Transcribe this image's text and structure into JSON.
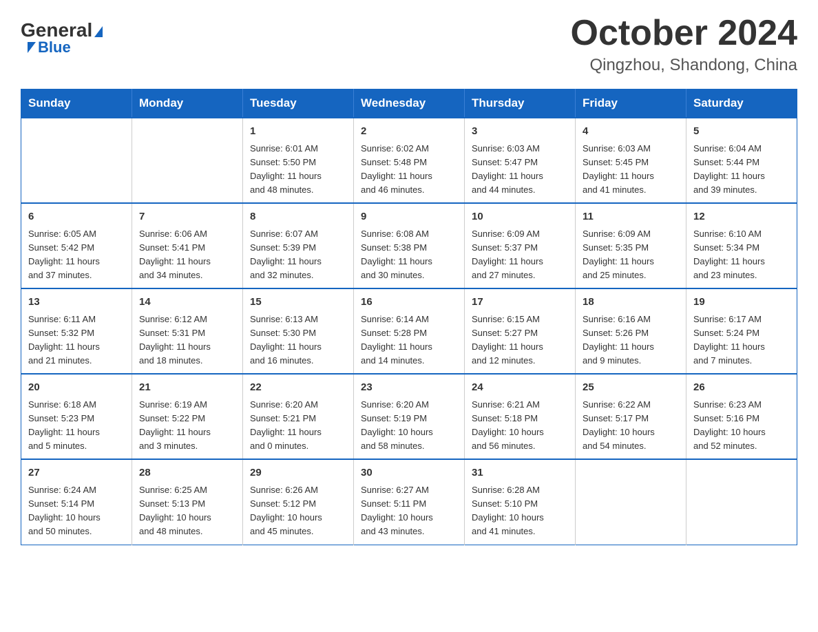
{
  "header": {
    "logo_general": "General",
    "logo_blue": "Blue",
    "month": "October 2024",
    "location": "Qingzhou, Shandong, China"
  },
  "weekdays": [
    "Sunday",
    "Monday",
    "Tuesday",
    "Wednesday",
    "Thursday",
    "Friday",
    "Saturday"
  ],
  "weeks": [
    [
      {
        "day": "",
        "info": ""
      },
      {
        "day": "",
        "info": ""
      },
      {
        "day": "1",
        "info": "Sunrise: 6:01 AM\nSunset: 5:50 PM\nDaylight: 11 hours\nand 48 minutes."
      },
      {
        "day": "2",
        "info": "Sunrise: 6:02 AM\nSunset: 5:48 PM\nDaylight: 11 hours\nand 46 minutes."
      },
      {
        "day": "3",
        "info": "Sunrise: 6:03 AM\nSunset: 5:47 PM\nDaylight: 11 hours\nand 44 minutes."
      },
      {
        "day": "4",
        "info": "Sunrise: 6:03 AM\nSunset: 5:45 PM\nDaylight: 11 hours\nand 41 minutes."
      },
      {
        "day": "5",
        "info": "Sunrise: 6:04 AM\nSunset: 5:44 PM\nDaylight: 11 hours\nand 39 minutes."
      }
    ],
    [
      {
        "day": "6",
        "info": "Sunrise: 6:05 AM\nSunset: 5:42 PM\nDaylight: 11 hours\nand 37 minutes."
      },
      {
        "day": "7",
        "info": "Sunrise: 6:06 AM\nSunset: 5:41 PM\nDaylight: 11 hours\nand 34 minutes."
      },
      {
        "day": "8",
        "info": "Sunrise: 6:07 AM\nSunset: 5:39 PM\nDaylight: 11 hours\nand 32 minutes."
      },
      {
        "day": "9",
        "info": "Sunrise: 6:08 AM\nSunset: 5:38 PM\nDaylight: 11 hours\nand 30 minutes."
      },
      {
        "day": "10",
        "info": "Sunrise: 6:09 AM\nSunset: 5:37 PM\nDaylight: 11 hours\nand 27 minutes."
      },
      {
        "day": "11",
        "info": "Sunrise: 6:09 AM\nSunset: 5:35 PM\nDaylight: 11 hours\nand 25 minutes."
      },
      {
        "day": "12",
        "info": "Sunrise: 6:10 AM\nSunset: 5:34 PM\nDaylight: 11 hours\nand 23 minutes."
      }
    ],
    [
      {
        "day": "13",
        "info": "Sunrise: 6:11 AM\nSunset: 5:32 PM\nDaylight: 11 hours\nand 21 minutes."
      },
      {
        "day": "14",
        "info": "Sunrise: 6:12 AM\nSunset: 5:31 PM\nDaylight: 11 hours\nand 18 minutes."
      },
      {
        "day": "15",
        "info": "Sunrise: 6:13 AM\nSunset: 5:30 PM\nDaylight: 11 hours\nand 16 minutes."
      },
      {
        "day": "16",
        "info": "Sunrise: 6:14 AM\nSunset: 5:28 PM\nDaylight: 11 hours\nand 14 minutes."
      },
      {
        "day": "17",
        "info": "Sunrise: 6:15 AM\nSunset: 5:27 PM\nDaylight: 11 hours\nand 12 minutes."
      },
      {
        "day": "18",
        "info": "Sunrise: 6:16 AM\nSunset: 5:26 PM\nDaylight: 11 hours\nand 9 minutes."
      },
      {
        "day": "19",
        "info": "Sunrise: 6:17 AM\nSunset: 5:24 PM\nDaylight: 11 hours\nand 7 minutes."
      }
    ],
    [
      {
        "day": "20",
        "info": "Sunrise: 6:18 AM\nSunset: 5:23 PM\nDaylight: 11 hours\nand 5 minutes."
      },
      {
        "day": "21",
        "info": "Sunrise: 6:19 AM\nSunset: 5:22 PM\nDaylight: 11 hours\nand 3 minutes."
      },
      {
        "day": "22",
        "info": "Sunrise: 6:20 AM\nSunset: 5:21 PM\nDaylight: 11 hours\nand 0 minutes."
      },
      {
        "day": "23",
        "info": "Sunrise: 6:20 AM\nSunset: 5:19 PM\nDaylight: 10 hours\nand 58 minutes."
      },
      {
        "day": "24",
        "info": "Sunrise: 6:21 AM\nSunset: 5:18 PM\nDaylight: 10 hours\nand 56 minutes."
      },
      {
        "day": "25",
        "info": "Sunrise: 6:22 AM\nSunset: 5:17 PM\nDaylight: 10 hours\nand 54 minutes."
      },
      {
        "day": "26",
        "info": "Sunrise: 6:23 AM\nSunset: 5:16 PM\nDaylight: 10 hours\nand 52 minutes."
      }
    ],
    [
      {
        "day": "27",
        "info": "Sunrise: 6:24 AM\nSunset: 5:14 PM\nDaylight: 10 hours\nand 50 minutes."
      },
      {
        "day": "28",
        "info": "Sunrise: 6:25 AM\nSunset: 5:13 PM\nDaylight: 10 hours\nand 48 minutes."
      },
      {
        "day": "29",
        "info": "Sunrise: 6:26 AM\nSunset: 5:12 PM\nDaylight: 10 hours\nand 45 minutes."
      },
      {
        "day": "30",
        "info": "Sunrise: 6:27 AM\nSunset: 5:11 PM\nDaylight: 10 hours\nand 43 minutes."
      },
      {
        "day": "31",
        "info": "Sunrise: 6:28 AM\nSunset: 5:10 PM\nDaylight: 10 hours\nand 41 minutes."
      },
      {
        "day": "",
        "info": ""
      },
      {
        "day": "",
        "info": ""
      }
    ]
  ]
}
